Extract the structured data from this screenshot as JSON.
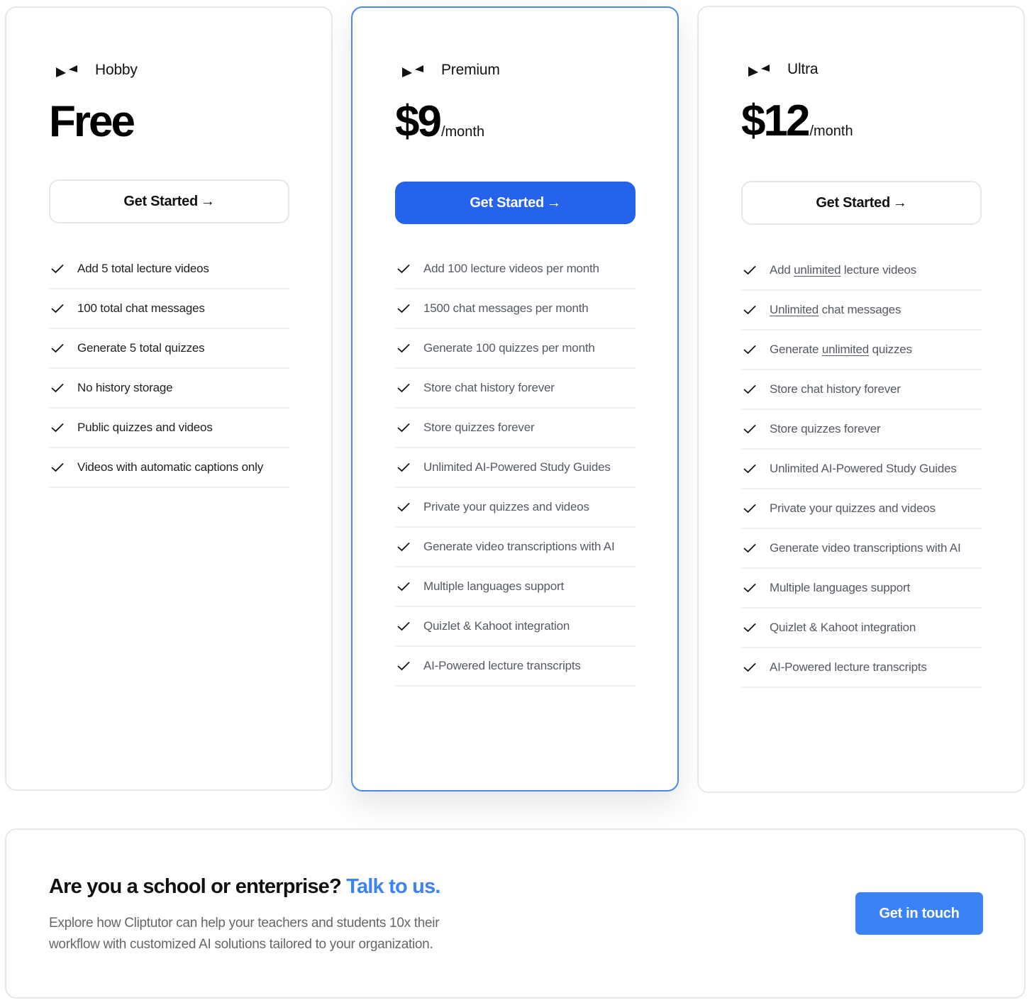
{
  "colors": {
    "primary": "#2563eb",
    "accent": "#3b82f6",
    "highlight_border": "#4a8af0",
    "card_border": "#e7e8ec"
  },
  "plans": [
    {
      "icon": "bowtie-logo-icon",
      "name": "Hobby",
      "price": "Free",
      "unit": "",
      "cta_label": "Get Started",
      "cta_arrow": "→",
      "features": [
        [
          {
            "t": "Add 5 total lecture videos"
          }
        ],
        [
          {
            "t": "100 total chat messages"
          }
        ],
        [
          {
            "t": "Generate 5 total quizzes"
          }
        ],
        [
          {
            "t": "No history storage"
          }
        ],
        [
          {
            "t": "Public quizzes and videos"
          }
        ],
        [
          {
            "t": "Videos with automatic captions only"
          }
        ]
      ]
    },
    {
      "icon": "bowtie-logo-icon",
      "name": "Premium",
      "price": "$9",
      "unit": "/month",
      "highlighted": true,
      "cta_label": "Get Started",
      "cta_arrow": "→",
      "features": [
        [
          {
            "t": "Add 100 lecture videos per month"
          }
        ],
        [
          {
            "t": "1500 chat messages per month"
          }
        ],
        [
          {
            "t": "Generate 100 quizzes per month"
          }
        ],
        [
          {
            "t": "Store chat history forever"
          }
        ],
        [
          {
            "t": "Store quizzes forever"
          }
        ],
        [
          {
            "t": "Unlimited AI-Powered Study Guides"
          }
        ],
        [
          {
            "t": "Private your quizzes and videos"
          }
        ],
        [
          {
            "t": "Generate video transcriptions with AI"
          }
        ],
        [
          {
            "t": "Multiple languages support"
          }
        ],
        [
          {
            "t": "Quizlet & Kahoot integration"
          }
        ],
        [
          {
            "t": "AI-Powered lecture transcripts"
          }
        ]
      ]
    },
    {
      "icon": "bowtie-logo-icon",
      "name": "Ultra",
      "price": "$12",
      "unit": "/month",
      "cta_label": "Get Started",
      "cta_arrow": "→",
      "features": [
        [
          {
            "t": "Add "
          },
          {
            "t": "unlimited",
            "u": true
          },
          {
            "t": " lecture videos"
          }
        ],
        [
          {
            "t": "Unlimited",
            "u": true
          },
          {
            "t": " chat messages"
          }
        ],
        [
          {
            "t": "Generate "
          },
          {
            "t": "unlimited",
            "u": true
          },
          {
            "t": " quizzes"
          }
        ],
        [
          {
            "t": "Store chat history forever"
          }
        ],
        [
          {
            "t": "Store quizzes forever"
          }
        ],
        [
          {
            "t": "Unlimited AI-Powered Study Guides"
          }
        ],
        [
          {
            "t": "Private your quizzes and videos"
          }
        ],
        [
          {
            "t": "Generate video transcriptions with AI"
          }
        ],
        [
          {
            "t": "Multiple languages support"
          }
        ],
        [
          {
            "t": "Quizlet & Kahoot integration"
          }
        ],
        [
          {
            "t": "AI-Powered lecture transcripts"
          }
        ]
      ]
    }
  ],
  "enterprise": {
    "title": "Are you a school or enterprise?",
    "title_accent": "Talk to us.",
    "description": "Explore how Cliptutor can help your teachers and students 10x their workflow with customized AI solutions tailored to your organization.",
    "button_label": "Get in touch"
  }
}
